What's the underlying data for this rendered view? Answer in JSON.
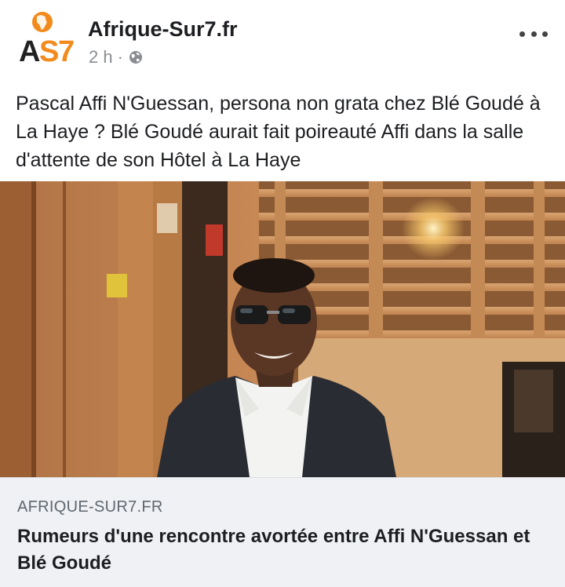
{
  "post": {
    "page_name": "Afrique-Sur7.fr",
    "logo_text": "AS7",
    "timestamp": "2 h",
    "separator": "·",
    "privacy_icon": "globe-icon",
    "more_icon": "more-options-icon",
    "text": "Pascal Affi N'Guessan, persona non grata chez Blé Goudé à La Haye ? Blé Goudé aurait fait poireauté Affi dans la salle d'attente de son Hôtel à La Haye"
  },
  "link_preview": {
    "domain": "AFRIQUE-SUR7.FR",
    "title": "Rumeurs d'une rencontre avortée entre Affi N'Guessan et Blé Goudé"
  },
  "colors": {
    "logo_orange": "#f28a1c",
    "logo_dark": "#222222",
    "preview_bg": "#eff1f4",
    "meta_gray": "#8a8d91"
  }
}
